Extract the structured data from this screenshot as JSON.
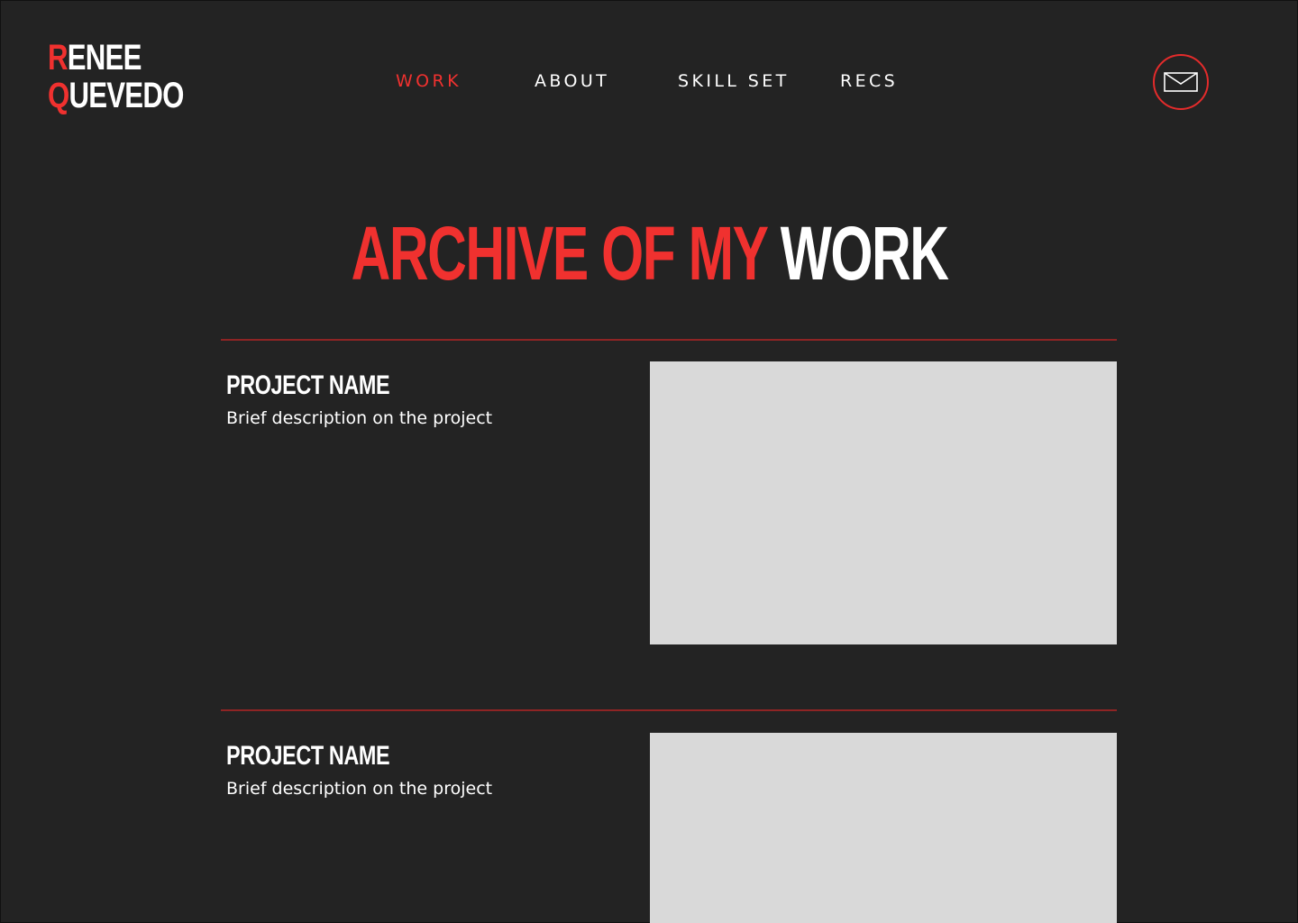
{
  "logo": {
    "first_initial": "R",
    "first_rest": "ENEE",
    "last_initial": "Q",
    "last_rest": "UEVEDO"
  },
  "nav": {
    "items": [
      {
        "label": "WORK",
        "active": true
      },
      {
        "label": "ABOUT",
        "active": false
      },
      {
        "label": "SKILL SET",
        "active": false
      },
      {
        "label": "RECS",
        "active": false
      }
    ]
  },
  "contact": {
    "icon": "mail-icon"
  },
  "page": {
    "title_red": "ARCHIVE OF MY",
    "title_white": "WORK"
  },
  "projects": [
    {
      "name": "PROJECT NAME",
      "description": "Brief description on the project"
    },
    {
      "name": "PROJECT NAME",
      "description": "Brief description on the project"
    }
  ],
  "colors": {
    "background": "#232323",
    "accent": "#f0312f",
    "divider": "#8e2424",
    "placeholder": "#d9d9d9",
    "text": "#ffffff"
  }
}
